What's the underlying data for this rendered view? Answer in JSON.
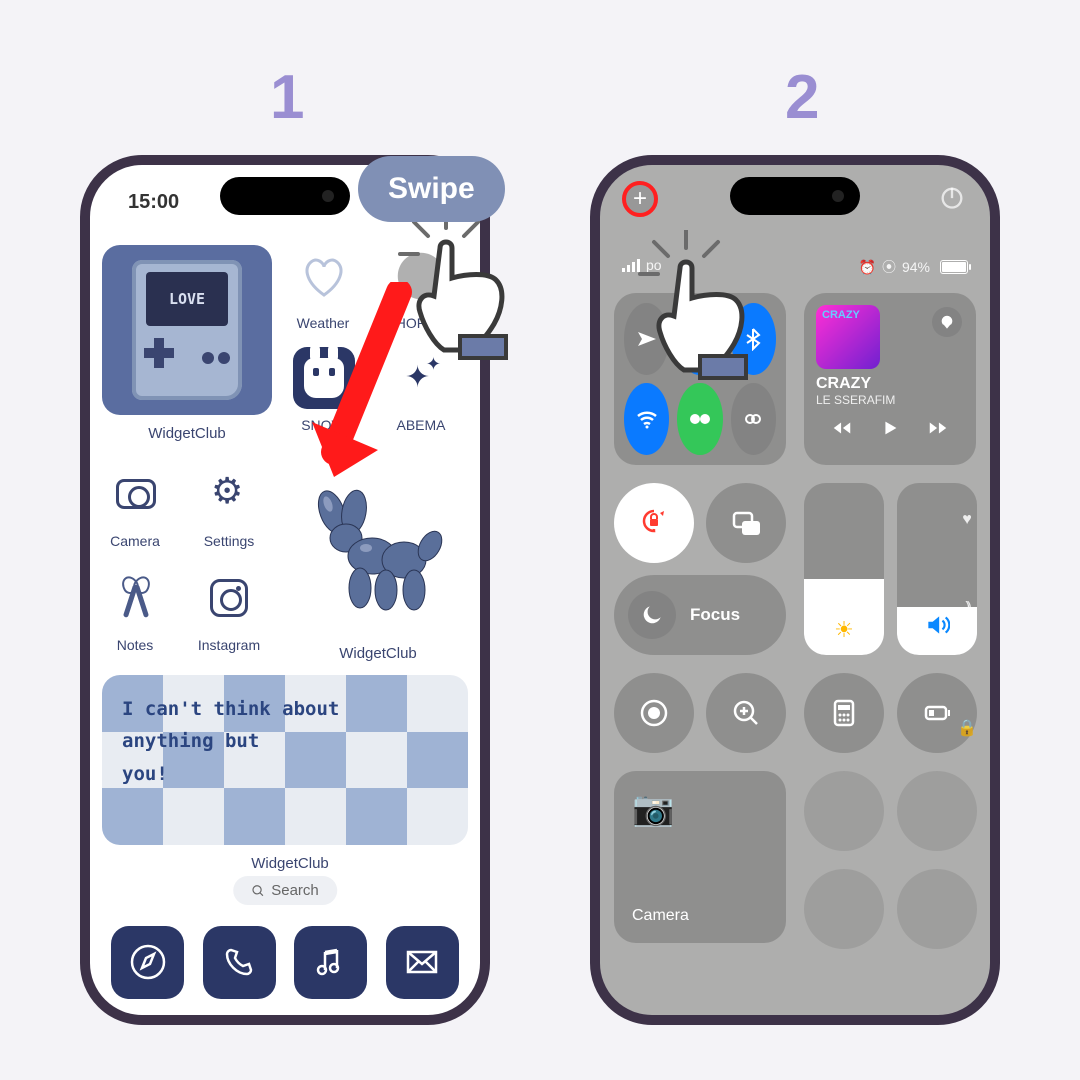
{
  "steps": {
    "one": "1",
    "two": "2"
  },
  "annotation": {
    "swipe": "Swipe"
  },
  "home": {
    "time": "15:00",
    "widget_big_label": "WidgetClub",
    "gameboy_text": "LOVE",
    "apps": {
      "weather": "Weather",
      "shoplist": "SHOPLIST",
      "snow": "SNOW",
      "abema": "ABEMA",
      "camera": "Camera",
      "settings": "Settings",
      "notes": "Notes",
      "instagram": "Instagram"
    },
    "widget_mid_label": "WidgetClub",
    "banner_text": "I can't think about\nanything but\nyou!",
    "widget_banner_label": "WidgetClub",
    "search": "Search"
  },
  "cc": {
    "carrier": "po",
    "battery": "94%",
    "music": {
      "title": "CRAZY",
      "artist": "LE SSERAFIM",
      "art_word": "CRAZY"
    },
    "focus": "Focus",
    "camera": "Camera"
  }
}
